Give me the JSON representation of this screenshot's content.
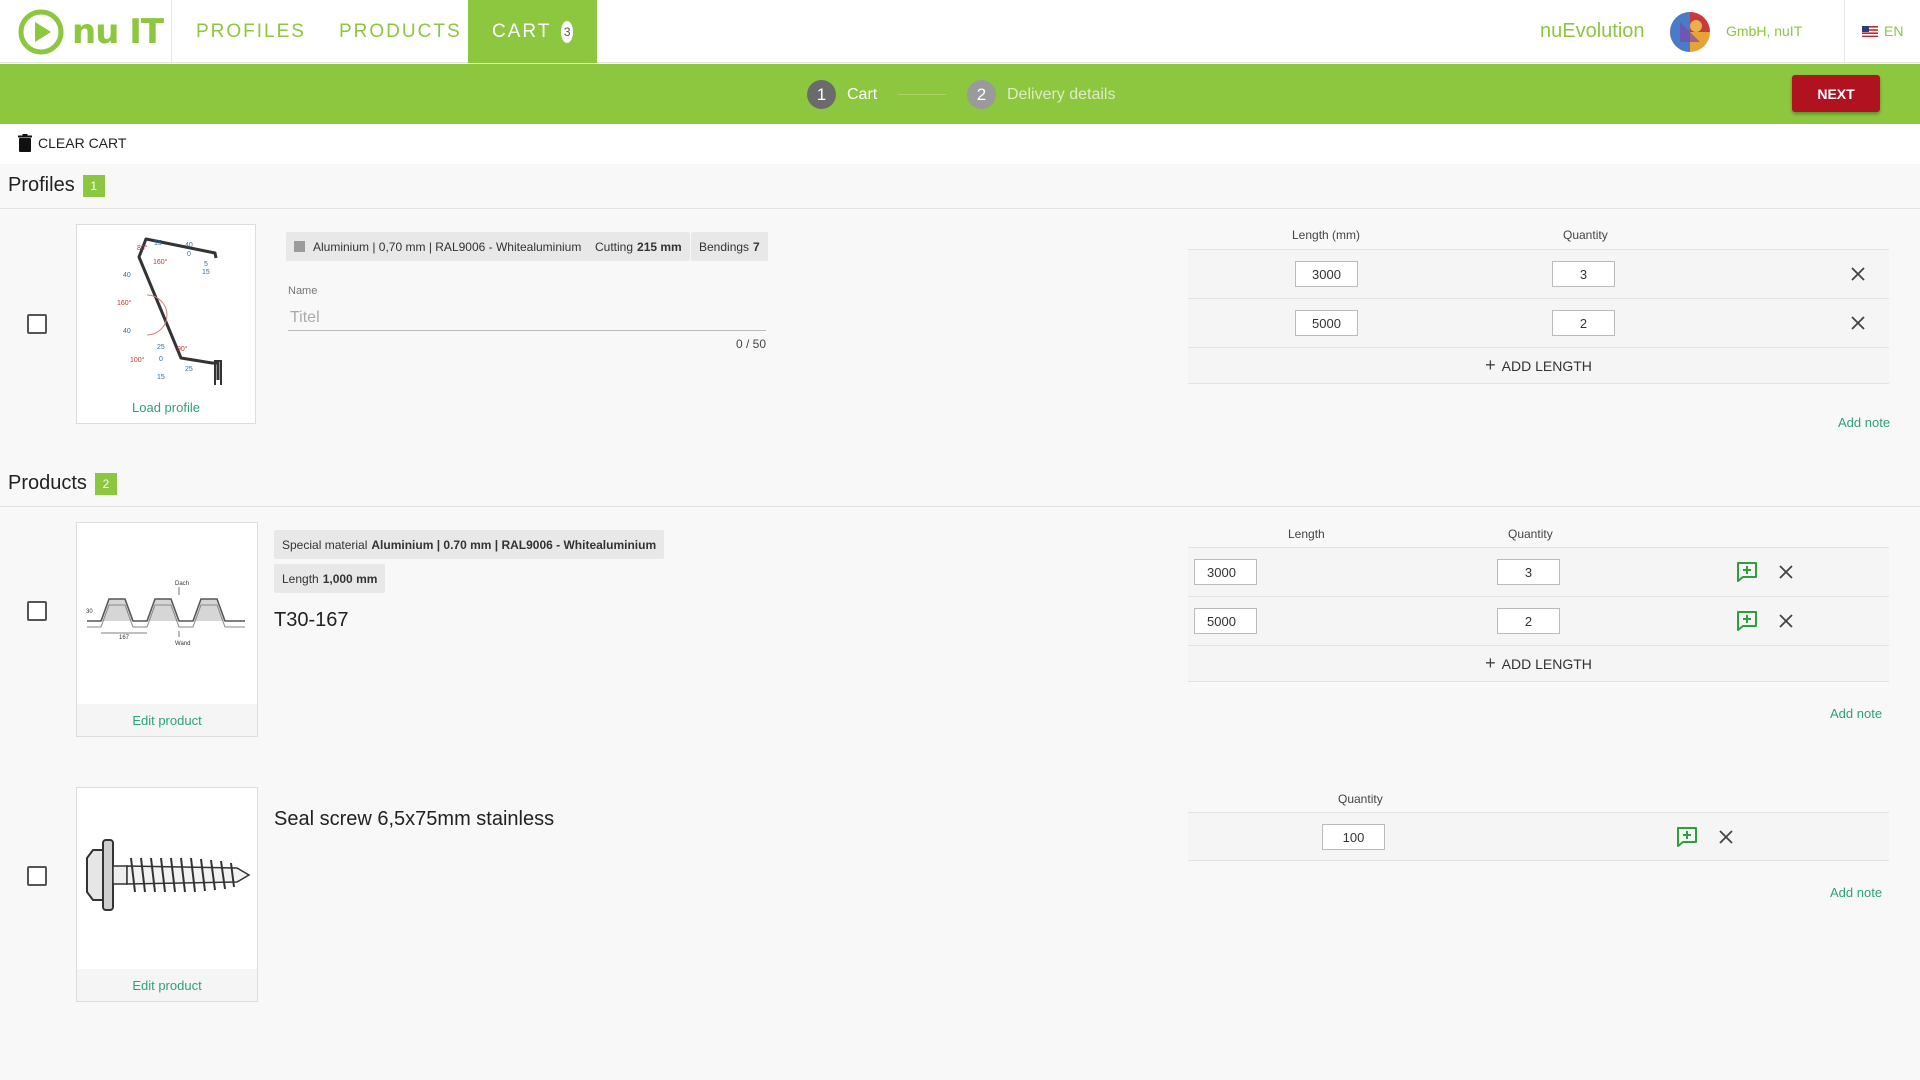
{
  "header": {
    "logo_text": "nu IT",
    "nav": {
      "profiles": "PROFILES",
      "products": "PRODUCTS",
      "cart": "CART",
      "cart_count": "3"
    },
    "org_name": "nuEvolution",
    "company": "GmbH, nuIT",
    "language": "EN"
  },
  "stepper": {
    "step1_num": "1",
    "step1_label": "Cart",
    "step2_num": "2",
    "step2_label": "Delivery details",
    "next_label": "NEXT"
  },
  "toolbar": {
    "clear_cart_label": "CLEAR CART"
  },
  "profiles_section": {
    "title": "Profiles",
    "count": "1",
    "item": {
      "thumb_link": "Load profile",
      "material_chip": "Aluminium | 0,70 mm | RAL9006 - Whitealuminium",
      "cutting_label": "Cutting",
      "cutting_value": "215 mm",
      "bendings_label": "Bendings",
      "bendings_value": "7",
      "name_label": "Name",
      "name_placeholder": "Titel",
      "name_counter": "0 / 50",
      "col_length": "Length  (mm)",
      "col_quantity": "Quantity",
      "rows": [
        {
          "length": "3000",
          "quantity": "3"
        },
        {
          "length": "5000",
          "quantity": "2"
        }
      ],
      "add_length": "ADD LENGTH",
      "add_note": "Add note",
      "drawing_labels": {
        "a80": "80°",
        "a160a": "160°",
        "a160b": "160°",
        "a100": "100°",
        "a90": "90°",
        "d15a": "15",
        "d40a": "40",
        "d0a": "0",
        "d5": "5",
        "d15b": "15",
        "d40b": "40",
        "d40c": "40",
        "d25a": "25",
        "d0b": "0",
        "d25b": "25",
        "d15c": "15"
      }
    }
  },
  "products_section": {
    "title": "Products",
    "count": "2",
    "items": [
      {
        "chip1_label": "Special material",
        "chip1_value": "Aluminium | 0.70 mm | RAL9006 - Whitealuminium",
        "chip2_label": "Length",
        "chip2_value": "1,000 mm",
        "title": "T30-167",
        "thumb_link": "Edit product",
        "col_length": "Length",
        "col_quantity": "Quantity",
        "rows": [
          {
            "length": "3000",
            "quantity": "3"
          },
          {
            "length": "5000",
            "quantity": "2"
          }
        ],
        "add_length": "ADD LENGTH",
        "add_note": "Add note",
        "drawing_labels": {
          "top": "Dach",
          "bottom": "Wand",
          "pitch": "167",
          "height": "30"
        }
      },
      {
        "title": "Seal screw 6,5x75mm stainless",
        "thumb_link": "Edit product",
        "col_quantity": "Quantity",
        "rows": [
          {
            "quantity": "100"
          }
        ],
        "add_note": "Add note"
      }
    ]
  },
  "colors": {
    "brand_green": "#8dc63f",
    "next_red": "#b0121f",
    "link_teal": "#2fa17a"
  },
  "icons": {
    "logo": "play-circle-icon",
    "clear": "trash-icon",
    "remove": "close-icon",
    "note": "add-comment-icon",
    "add": "plus-icon"
  }
}
